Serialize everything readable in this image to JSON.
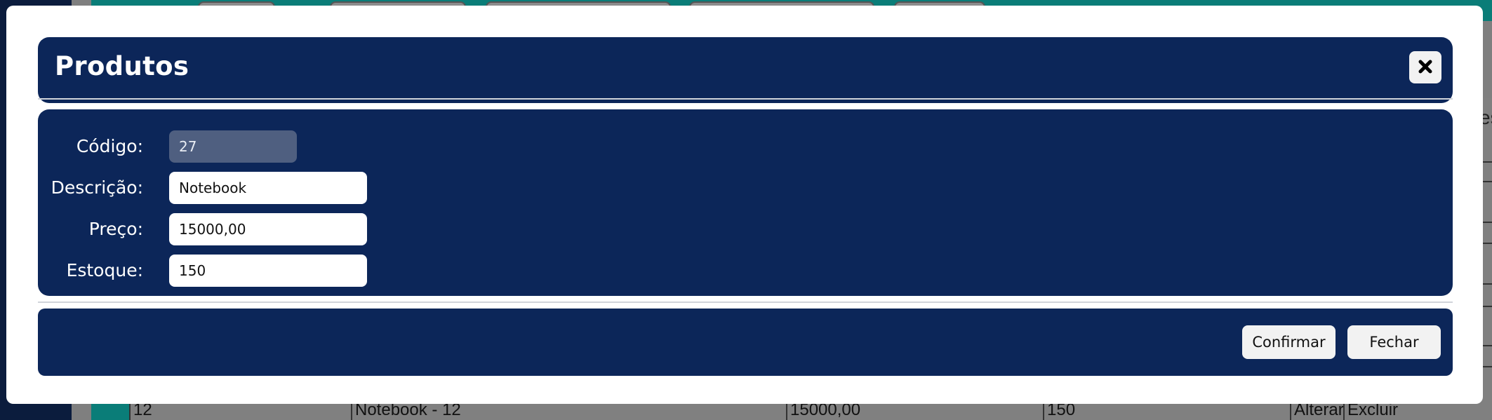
{
  "modal": {
    "title": "Produtos",
    "close_icon": "close-icon",
    "fields": [
      {
        "label": "Código:",
        "value": "27"
      },
      {
        "label": "Descrição:",
        "value": "Notebook"
      },
      {
        "label": "Preço:",
        "value": "15000,00"
      },
      {
        "label": "Estoque:",
        "value": "150"
      }
    ],
    "buttons": {
      "confirm": "Confirmar",
      "close": "Fechar"
    }
  },
  "background": {
    "edge_text": "es",
    "row": {
      "code": "12",
      "description": "Notebook - 12",
      "price": "15000,00",
      "stock": "150",
      "edit": "Alterar",
      "delete": "Excluir"
    }
  },
  "colors": {
    "panel": "#0c2659",
    "overlay_page": "#0b1c3d",
    "teal": "#0a7d78"
  }
}
